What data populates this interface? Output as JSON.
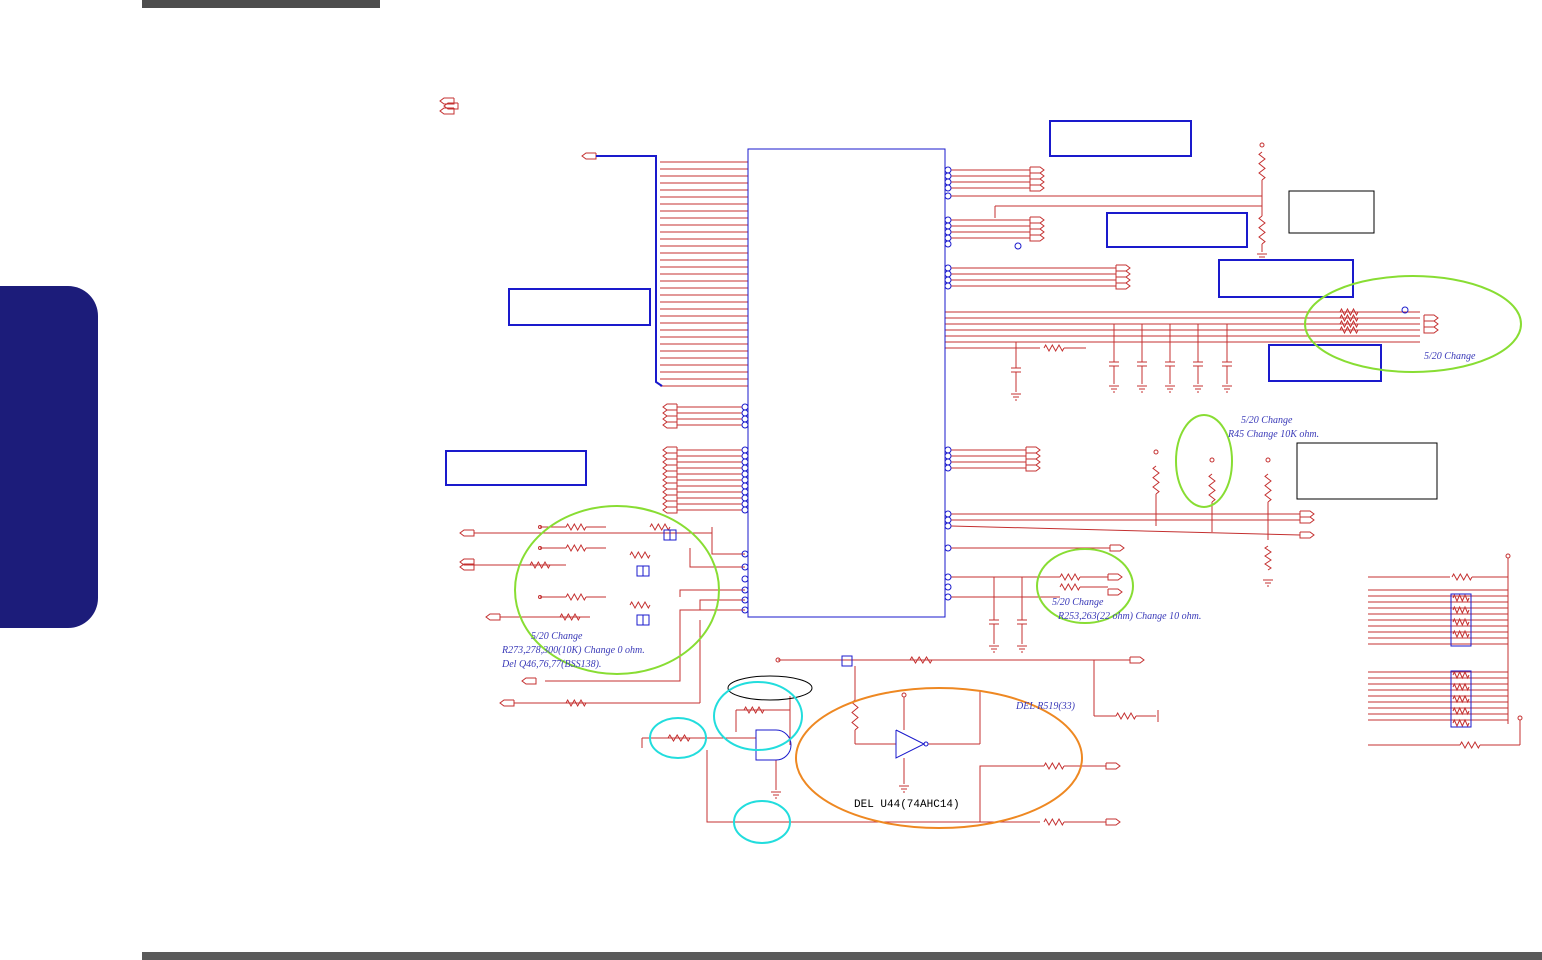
{
  "page": {
    "side_tab_label": ""
  },
  "notes": {
    "n1": "5/20 Change",
    "n2": "5/20 Change",
    "n3": "R45 Change 10K ohm.",
    "n4": "5/20 Change",
    "n5": "R273,278,300(10K) Change 0 ohm.",
    "n6": "Del Q46,76,77(BSS138).",
    "n7": "5/20 Change",
    "n8": "R253,263(22 ohm) Change 10 ohm.",
    "n9": "DEL R519(33)",
    "n10": "DEL U44(74AHC14)"
  },
  "colors": {
    "wire": "#c43030",
    "blue": "#1a1acc",
    "dark_blue_tab": "#1c1c7a",
    "green_highlight": "#88dd33",
    "cyan_highlight": "#22dddd",
    "orange_highlight": "#ee8822",
    "note_text": "#3a3ab8"
  }
}
